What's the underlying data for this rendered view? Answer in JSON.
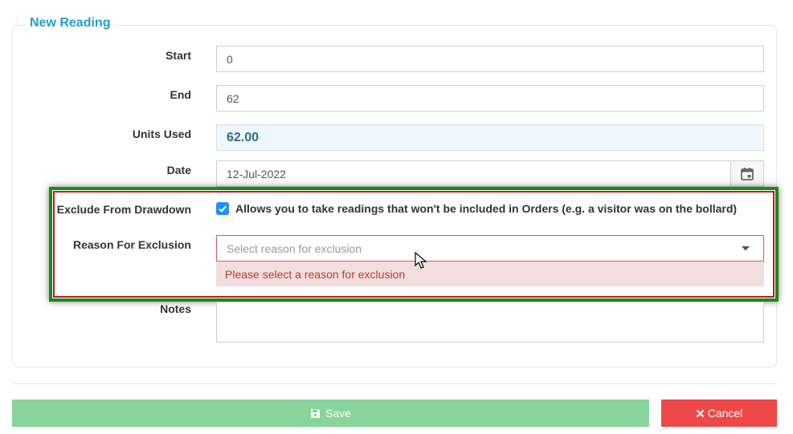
{
  "form": {
    "legend": "New Reading",
    "start": {
      "label": "Start",
      "value": "0"
    },
    "end": {
      "label": "End",
      "value": "62"
    },
    "units_used": {
      "label": "Units Used",
      "value": "62.00"
    },
    "date": {
      "label": "Date",
      "value": "12-Jul-2022",
      "icon": "calendar-icon"
    },
    "exclude": {
      "label": "Exclude From Drawdown",
      "checked": true,
      "text": "Allows you to take readings that won't be included in Orders (e.g. a visitor was on the bollard)"
    },
    "reason": {
      "label": "Reason For Exclusion",
      "placeholder": "Select reason for exclusion",
      "error": "Please select a reason for exclusion"
    },
    "notes": {
      "label": "Notes",
      "value": ""
    }
  },
  "actions": {
    "save_label": "Save",
    "cancel_label": "Cancel"
  },
  "colors": {
    "accent": "#1e9fd8",
    "save": "#88d49a",
    "cancel": "#ef4848",
    "error_bg": "#f2dede",
    "highlight_outer": "#1a8a1a",
    "highlight_inner": "#c41a1a"
  }
}
